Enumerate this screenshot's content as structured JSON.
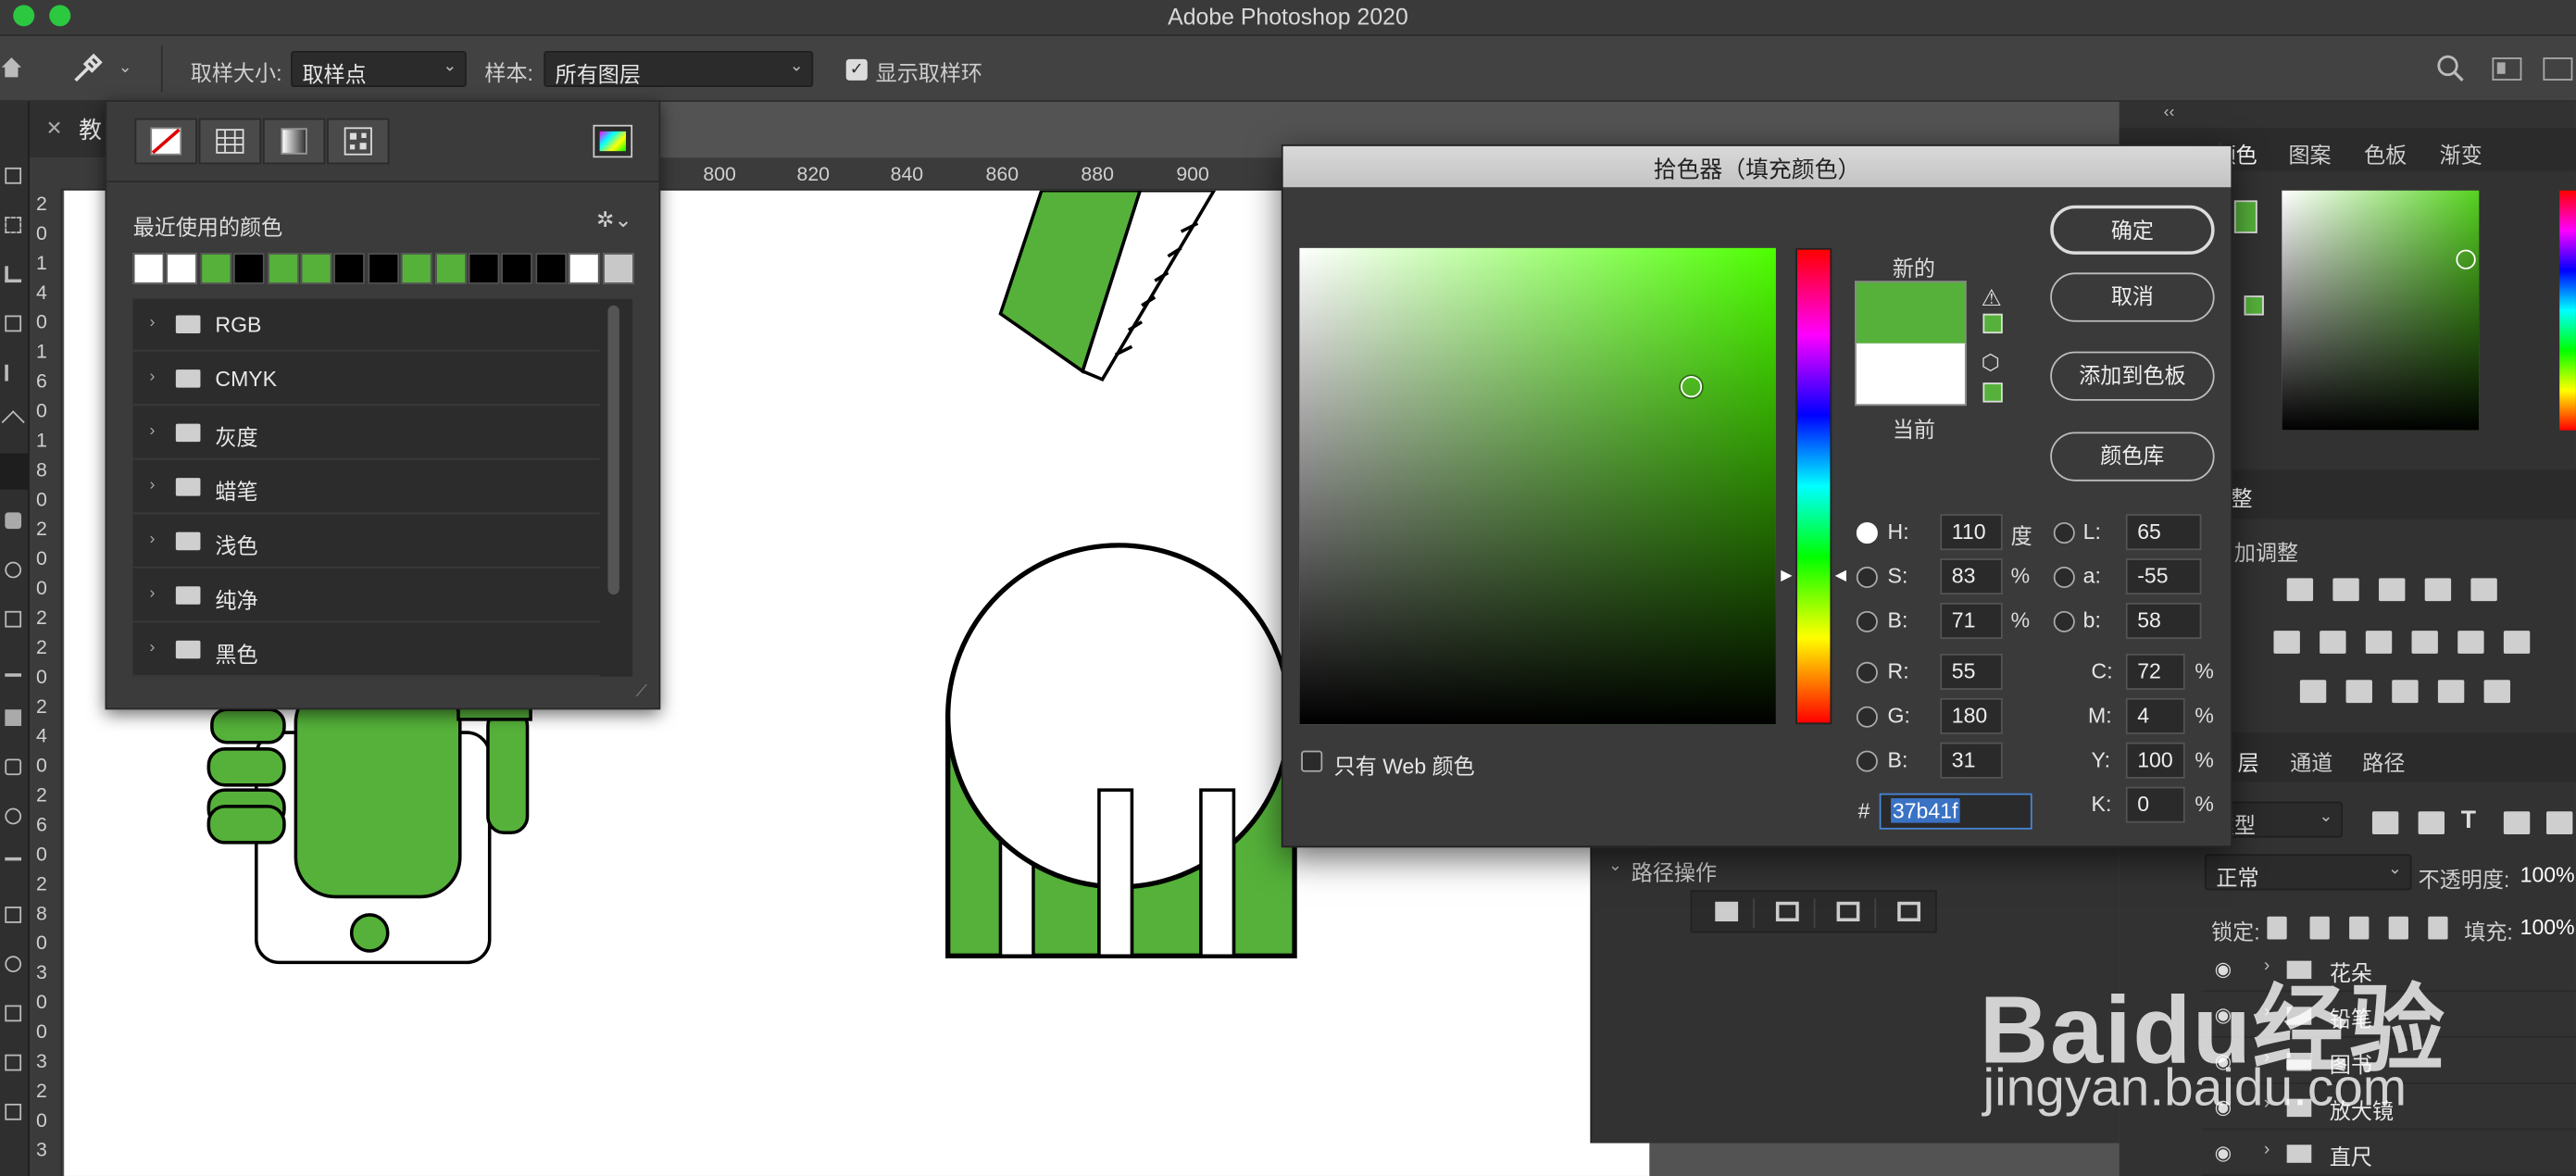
{
  "app": {
    "title": "Adobe Photoshop 2020"
  },
  "options_bar": {
    "sample_size_label": "取样大小:",
    "sample_size_value": "取样点",
    "sample_label": "样本:",
    "sample_value": "所有图层",
    "show_ring_label": "显示取样环"
  },
  "document": {
    "tab_title": "教"
  },
  "ruler": {
    "ticks": [
      "800",
      "820",
      "840",
      "860",
      "880",
      "900"
    ],
    "v_ticks": [
      "2",
      "0",
      "1",
      "4",
      "0",
      "1",
      "6",
      "0",
      "1",
      "8",
      "0",
      "2",
      "0",
      "0",
      "2",
      "2",
      "0",
      "2",
      "4",
      "0",
      "2",
      "6",
      "0",
      "2",
      "8",
      "0",
      "3",
      "0",
      "0",
      "3",
      "2",
      "0",
      "3"
    ]
  },
  "swatches_panel": {
    "recent_label": "最近使用的颜色",
    "recent_colors": [
      "#ffffff",
      "#ffffff",
      "#55b13a",
      "#000000",
      "#55b13a",
      "#55b13a",
      "#000000",
      "#000000",
      "#55b13a",
      "#55b13a",
      "#000000",
      "#000000",
      "#000000",
      "#ffffff",
      "#c8c8c8"
    ],
    "folders": [
      "RGB",
      "CMYK",
      "灰度",
      "蜡笔",
      "浅色",
      "纯净",
      "黑色"
    ]
  },
  "color_picker": {
    "title": "拾色器（填充颜色）",
    "new_label": "新的",
    "current_label": "当前",
    "new_color": "#55b13a",
    "current_color": "#ffffff",
    "ok_label": "确定",
    "cancel_label": "取消",
    "add_to_swatches_label": "添加到色板",
    "color_libraries_label": "颜色库",
    "web_colors_label": "只有 Web 颜色",
    "fields": {
      "h_label": "H:",
      "h_value": "110",
      "h_unit": "度",
      "s_label": "S:",
      "s_value": "83",
      "s_unit": "%",
      "b_label": "B:",
      "b_value": "71",
      "b_unit": "%",
      "r_label": "R:",
      "r_value": "55",
      "g_label": "G:",
      "g_value": "180",
      "bb_label": "B:",
      "bb_value": "31",
      "l_label": "L:",
      "l_value": "65",
      "a_label": "a:",
      "a_value": "-55",
      "lb_label": "b:",
      "lb_value": "58",
      "c_label": "C:",
      "c_value": "72",
      "c_unit": "%",
      "m_label": "M:",
      "m_value": "4",
      "m_unit": "%",
      "y_label": "Y:",
      "y_value": "100",
      "y_unit": "%",
      "k_label": "K:",
      "k_value": "0",
      "k_unit": "%",
      "hex_label": "#",
      "hex_value": "37b41f"
    }
  },
  "right_panel": {
    "color_tabs": [
      "颜色",
      "图案",
      "色板",
      "渐变"
    ],
    "adjustments_header": "整",
    "adjustments_sub": "加调整",
    "layers_tabs": [
      "层",
      "通道",
      "路径"
    ],
    "kind_label": "类型",
    "blend_mode": "正常",
    "opacity_label": "不透明度:",
    "opacity_value": "100%",
    "lock_label": "锁定:",
    "fill_label": "填充:",
    "fill_value": "100%",
    "layers": [
      "花朵",
      "铅笔",
      "图书",
      "放大镜",
      "直尺"
    ]
  },
  "path_ops": {
    "label": "路径操作"
  },
  "watermark": {
    "brand": "Baidu经验",
    "url": "jingyan.baidu.com"
  },
  "colors": {
    "accent_green": "#55b13a",
    "hex_highlight": "#3a72c4"
  }
}
